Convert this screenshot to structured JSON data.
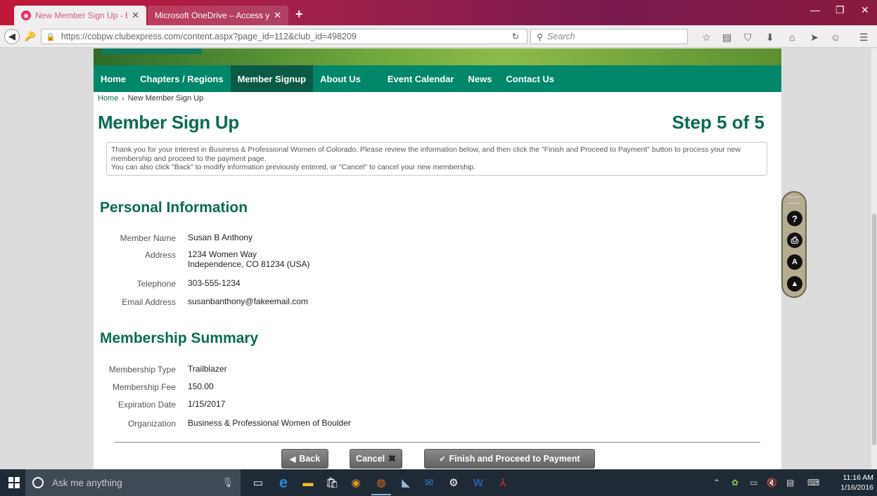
{
  "browser": {
    "tabs": [
      {
        "title": "New Member Sign Up - B...",
        "active": true
      },
      {
        "title": "Microsoft OneDrive – Access y...",
        "active": false
      }
    ],
    "url": "https://cobpw.clubexpress.com/content.aspx?page_id=112&club_id=498209",
    "url_domain": "clubexpress.com",
    "search_placeholder": "Search",
    "icons": [
      "back-icon",
      "identity-icon",
      "lock-icon",
      "reload-icon",
      "search-icon",
      "star-icon",
      "reading-list-icon",
      "pocket-icon",
      "download-icon",
      "home-icon",
      "send-icon",
      "chat-icon",
      "menu-icon"
    ]
  },
  "site": {
    "nav": [
      {
        "label": "Home",
        "active": false
      },
      {
        "label": "Chapters / Regions",
        "active": false
      },
      {
        "label": "Member Signup",
        "active": true
      },
      {
        "label": "About Us",
        "active": false
      },
      {
        "label": "Event Calendar",
        "active": false
      },
      {
        "label": "News",
        "active": false
      },
      {
        "label": "Contact Us",
        "active": false
      }
    ],
    "breadcrumb": {
      "home": "Home",
      "current": "New Member Sign Up"
    },
    "colors": {
      "brand_green": "#00876a",
      "heading_green": "#0b6b55"
    }
  },
  "page": {
    "title": "Member Sign Up",
    "step": "Step 5 of 5",
    "intro_line1": "Thank you for your interest in Business & Professional Women of Colorado. Please review the information below, and then click the \"Finish and Proceed to Payment\" button to process your new membership and proceed to the payment page.",
    "intro_line2": "You can also click \"Back\" to modify information previously entered, or \"Cancel\" to cancel your new membership."
  },
  "personal": {
    "heading": "Personal Information",
    "fields": [
      {
        "label": "Member Name",
        "value": "Susan B Anthony"
      },
      {
        "label": "Address",
        "value": "1234 Women Way",
        "value2": "Independence, CO 81234 (USA)"
      },
      {
        "label": "Telephone",
        "value": "303-555-1234"
      },
      {
        "label": "Email Address",
        "value": "susanbanthony@fakeemail.com"
      }
    ]
  },
  "membership": {
    "heading": "Membership Summary",
    "fields": [
      {
        "label": "Membership Type",
        "value": "Trailblazer"
      },
      {
        "label": "Membership Fee",
        "value": "150.00"
      },
      {
        "label": "Expiration Date",
        "value": "1/15/2017"
      },
      {
        "label": "Organization",
        "value": "Business & Professional Women of Boulder"
      }
    ]
  },
  "buttons": {
    "back": "Back",
    "cancel": "Cancel",
    "finish": "Finish and Proceed to Payment"
  },
  "floating_toolbar": {
    "buttons": [
      "help-icon",
      "print-icon",
      "text-size-icon",
      "navigate-up-icon"
    ]
  },
  "taskbar": {
    "search_placeholder": "Ask me anything",
    "time": "11:16 AM",
    "date": "1/16/2016"
  }
}
